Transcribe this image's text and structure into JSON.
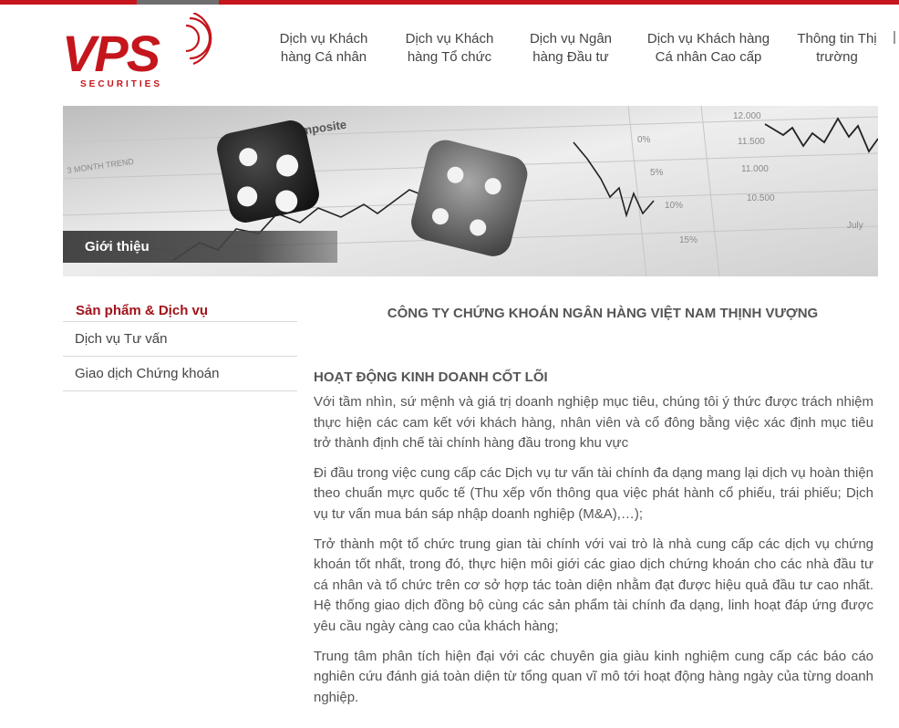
{
  "colors": {
    "brand_red": "#c4161c",
    "heading_red": "#a3111a",
    "text_gray": "#555555"
  },
  "logo": {
    "wordmark": "VPS",
    "tagline": "SECURITIES",
    "icon": "signal-waves-icon"
  },
  "nav": {
    "items": [
      {
        "line1": "Dịch vụ Khách",
        "line2": "hàng Cá nhân"
      },
      {
        "line1": "Dịch vụ Khách",
        "line2": "hàng Tổ chức"
      },
      {
        "line1": "Dịch vụ Ngân",
        "line2": "hàng Đầu tư"
      },
      {
        "line1": "Dịch vụ Khách hàng",
        "line2": "Cá nhân Cao cấp"
      },
      {
        "line1": "Thông tin Thị",
        "line2": "trường"
      }
    ]
  },
  "banner": {
    "title": "Giới thiệu",
    "image_text": {
      "composite": "Composite",
      "month_trend": "3 MONTH TREND",
      "pct_0": "0%",
      "pct_5": "5%",
      "pct_10": "10%",
      "pct_15": "15%",
      "val_12000": "12.000",
      "val_11500": "11.500",
      "val_11000": "11.000",
      "val_10500": "10.500",
      "july": "July"
    }
  },
  "sidebar": {
    "heading": "Sản phẩm & Dịch vụ",
    "items": [
      "Dịch vụ Tư vấn",
      "Giao dịch Chứng khoán"
    ]
  },
  "content": {
    "company_name": "CÔNG TY CHỨNG KHOÁN NGÂN HÀNG VIỆT NAM THỊNH VƯỢNG",
    "section_title": "HOẠT ĐỘNG KINH DOANH CỐT LÕI",
    "paragraphs": [
      "Với tầm nhìn, sứ mệnh và giá trị doanh nghiệp mục tiêu, chúng tôi ý thức được trách nhiệm thực hiện các cam kết với khách hàng, nhân viên và cổ đông bằng việc xác định mục tiêu trở thành định chế tài chính hàng đầu trong khu vực",
      "Đi đầu trong việc cung cấp các Dịch vụ tư vấn tài chính đa dạng mang lại dịch vụ hoàn thiện theo chuẩn mực quốc tế (Thu xếp vốn thông qua việc phát hành cổ phiếu, trái phiếu; Dịch vụ tư vấn mua bán sáp nhập doanh nghiệp (M&A),…);",
      "Trở thành một tổ chức trung gian tài chính với vai trò là nhà cung cấp các dịch vụ chứng khoán tốt nhất, trong đó, thực hiện môi giới các giao dịch chứng khoán cho các nhà đầu tư cá nhân và tổ chức trên cơ sở hợp tác toàn diện nhằm đạt được hiệu quả đầu tư cao nhất. Hệ thống giao dịch đồng bộ cùng các sản phẩm tài chính đa dạng, linh hoạt đáp ứng được yêu cầu ngày càng cao của khách hàng;",
      "Trung tâm phân tích hiện đại với các chuyên gia giàu kinh nghiệm cung cấp các báo cáo nghiên cứu đánh giá toàn diện từ tổng quan vĩ mô tới hoạt động hàng ngày của từng doanh nghiệp."
    ]
  }
}
